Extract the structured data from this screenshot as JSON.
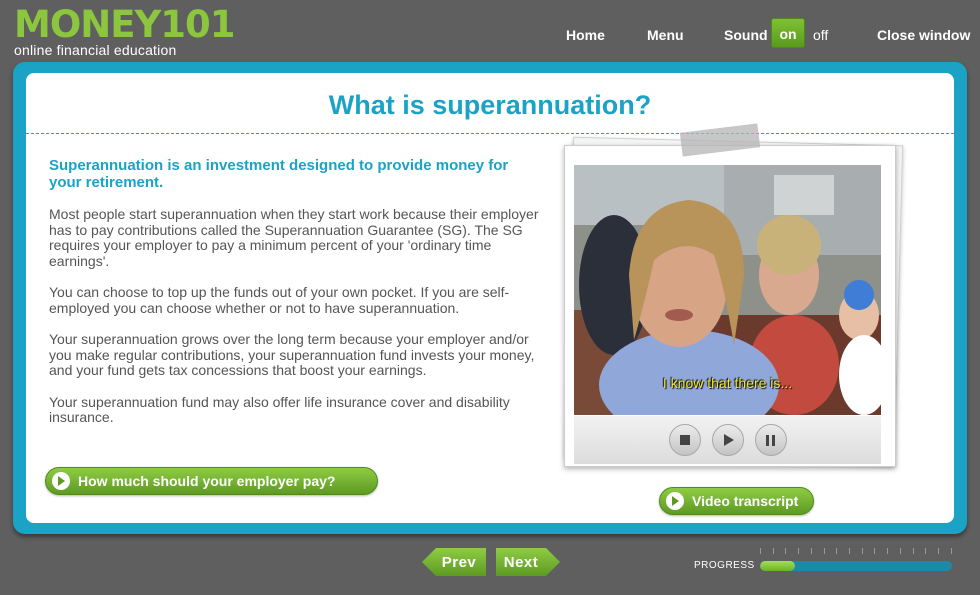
{
  "brand": {
    "name": "MONEY101",
    "tagline": "online financial education"
  },
  "nav": {
    "home": "Home",
    "menu": "Menu",
    "sound_label": "Sound",
    "sound_on": "on",
    "sound_off": "off",
    "close": "Close window"
  },
  "page": {
    "title": "What is superannuation?",
    "lead": "Superannuation is an investment designed to provide money for your retirement.",
    "paragraphs": [
      "Most people start superannuation when they start work because their employer has to pay contributions called the Superannuation Guarantee (SG). The SG requires your employer to pay a minimum percent of your 'ordinary time earnings'.",
      "You can choose to top up the funds out of your own pocket. If you are self-employed you can choose whether or not to have superannuation.",
      "Your superannuation grows over the long term because your employer and/or you make regular contributions, your superannuation fund invests your money, and your fund gets tax concessions that boost your earnings.",
      "Your superannuation fund may also offer life insurance cover and disability insurance."
    ],
    "employer_button": "How much should your employer pay?"
  },
  "video": {
    "subtitle": "I know that there is...",
    "transcript_button": "Video transcript",
    "controls": [
      "stop-icon",
      "play-icon",
      "pause-icon"
    ]
  },
  "footer": {
    "prev": "Prev",
    "next": "Next",
    "progress_label": "PROGRESS",
    "progress_fraction": 0.18
  },
  "colors": {
    "brand_green": "#8cc63f",
    "accent_blue": "#1ba3c6",
    "background": "#5f5f5f"
  }
}
